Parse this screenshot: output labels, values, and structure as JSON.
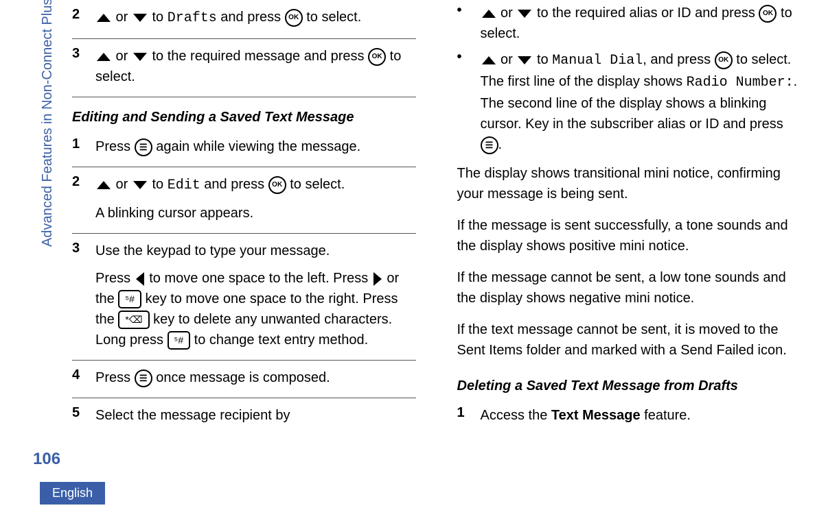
{
  "sidebar": {
    "label": "Advanced Features in Non-Connect Plus Mode"
  },
  "pageNumber": "106",
  "language": "English",
  "col1": {
    "step2": {
      "num": "2",
      "t1": " or ",
      "t2": " to ",
      "drafts": "Drafts",
      "t3": " and press ",
      "t4": " to select."
    },
    "step3": {
      "num": "3",
      "t1": " or ",
      "t2": " to the required message and press ",
      "t3": " to select."
    },
    "heading1": "Editing and Sending a Saved Text Message",
    "e1": {
      "num": "1",
      "t1": "Press ",
      "t2": " again while viewing the message."
    },
    "e2": {
      "num": "2",
      "t1": " or ",
      "t2": " to ",
      "edit": "Edit",
      "t3": " and press ",
      "t4": " to select.",
      "p2": "A blinking cursor appears."
    },
    "e3": {
      "num": "3",
      "p1": "Use the keypad to type your message.",
      "p2a": "Press ",
      "p2b": " to move one space to the left. Press ",
      "p2c": " or the ",
      "p2d": " key to move one space to the right. Press the ",
      "p2e": " key to delete any unwanted characters. Long press ",
      "p2f": " to change text entry method."
    },
    "e4": {
      "num": "4",
      "t1": "Press ",
      "t2": " once message is composed."
    },
    "e5": {
      "num": "5",
      "t1": "Select the message recipient by"
    }
  },
  "col2": {
    "b1": {
      "t1": " or ",
      "t2": " to the required alias or ID and press ",
      "t3": " to select."
    },
    "b2": {
      "t1": " or ",
      "t2": " to ",
      "manual": "Manual Dial",
      "t3": ", and press ",
      "t4": " to select. The first line of the display shows ",
      "radio": "Radio Number:",
      "t5": ". The second line of the display shows a blinking cursor. Key in the subscriber alias or ID and press ",
      "t6": "."
    },
    "p1": "The display shows transitional mini notice, confirming your message is being sent.",
    "p2": "If the message is sent successfully, a tone sounds and the display shows positive mini notice.",
    "p3": "If the message cannot be sent, a low tone sounds and the display shows negative mini notice.",
    "p4": "If the text message cannot be sent, it is moved to the Sent Items folder and marked with a Send Failed icon.",
    "heading2": "Deleting a Saved Text Message from Drafts",
    "d1": {
      "num": "1",
      "t1": "Access the ",
      "bold": "Text Message",
      "t2": " feature."
    }
  }
}
